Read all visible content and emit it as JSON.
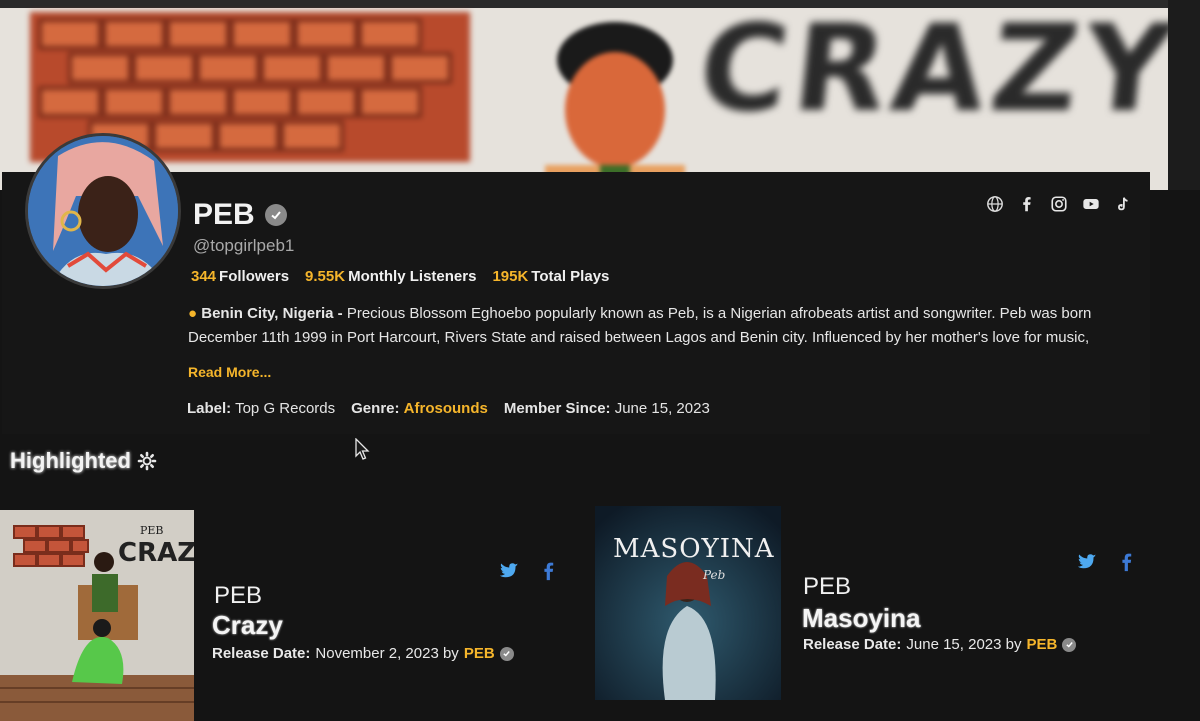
{
  "artist": {
    "name": "PEB",
    "handle": "@topgirlpeb1"
  },
  "stats": [
    {
      "value": "344",
      "label": "Followers"
    },
    {
      "value": "9.55K",
      "label": "Monthly Listeners"
    },
    {
      "value": "195K",
      "label": "Total Plays"
    }
  ],
  "bio": {
    "location": "Benin City, Nigeria -",
    "text": "Precious Blossom Eghoebo popularly known as Peb, is a Nigerian afrobeats artist and songwriter. Peb was born December 11th 1999 in Port Harcourt, Rivers State and raised between Lagos and Benin city. Influenced by her mother's love for music,",
    "read_more": "Read More..."
  },
  "meta": {
    "label_key": "Label:",
    "label_value": "Top G Records",
    "genre_key": "Genre:",
    "genre_value": "Afrosounds",
    "member_key": "Member Since:",
    "member_value": "June 15, 2023"
  },
  "social_icons": [
    "globe-icon",
    "facebook-icon",
    "instagram-icon",
    "youtube-icon",
    "tiktok-icon"
  ],
  "banner": {
    "text": "CRAZY"
  },
  "highlighted": {
    "title": "Highlighted",
    "cards": [
      {
        "art_brand": "PEB",
        "art_title": "CRAZY",
        "artist": "PEB",
        "title": "Crazy",
        "release_label": "Release Date:",
        "release_date": "November 2, 2023 by",
        "by": "PEB"
      },
      {
        "art_title": "MASOYINA",
        "art_sign": "Peb",
        "artist": "PEB",
        "title": "Masoyina",
        "release_label": "Release Date:",
        "release_date": "June 15, 2023 by",
        "by": "PEB"
      }
    ]
  },
  "colors": {
    "accent": "#f5b52b",
    "background": "#141414",
    "panel": "#161616"
  }
}
